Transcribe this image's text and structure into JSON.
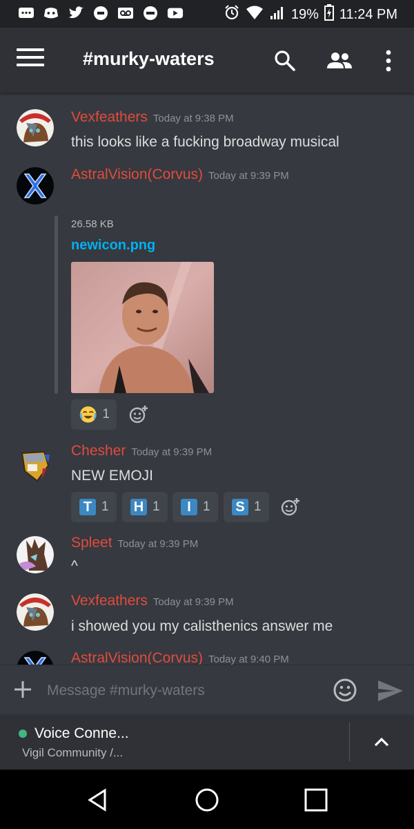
{
  "status_bar": {
    "battery": "19%",
    "time": "11:24 PM"
  },
  "header": {
    "channel": "#murky-waters"
  },
  "messages": [
    {
      "author": "Vexfeathers",
      "timestamp": "Today at 9:38 PM",
      "text": "this looks like a fucking broadway musical"
    },
    {
      "author": "AstralVision(Corvus)",
      "timestamp": "Today at 9:39 PM",
      "attachment": {
        "size": "26.58 KB",
        "filename": "newicon.png"
      },
      "reactions": [
        {
          "emoji": "joy",
          "count": "1"
        }
      ]
    },
    {
      "author": "Chesher",
      "timestamp": "Today at 9:39 PM",
      "text": "NEW EMOJI",
      "reactions": [
        {
          "letter": "T",
          "count": "1"
        },
        {
          "letter": "H",
          "count": "1"
        },
        {
          "letter": "I",
          "count": "1"
        },
        {
          "letter": "S",
          "count": "1"
        }
      ]
    },
    {
      "author": "Spleet",
      "timestamp": "Today at 9:39 PM",
      "text": "^"
    },
    {
      "author": "Vexfeathers",
      "timestamp": "Today at 9:39 PM",
      "text": "i showed you my calisthenics answer me"
    },
    {
      "author": "AstralVision(Corvus)",
      "timestamp": "Today at 9:40 PM"
    }
  ],
  "composer": {
    "placeholder": "Message #murky-waters"
  },
  "voice": {
    "title": "Voice Conne...",
    "subtitle": "Vigil Community /..."
  },
  "colors": {
    "author": "#e24b3f",
    "link": "#00b0f4",
    "online": "#43b581",
    "background": "#36393f"
  }
}
